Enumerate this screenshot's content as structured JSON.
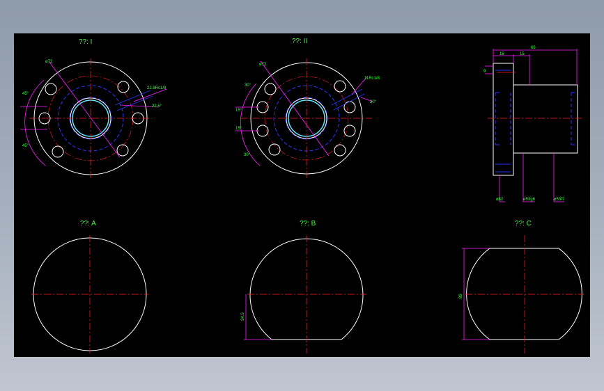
{
  "views": {
    "view_1": {
      "title": "??: I"
    },
    "view_2": {
      "title": "??: II"
    },
    "view_a": {
      "title": "??: A"
    },
    "view_b": {
      "title": "??: B"
    },
    "view_c": {
      "title": "??: C"
    }
  },
  "dims": {
    "v1_dia": "ø72",
    "v1_ang_top": "45°",
    "v1_ang_bot": "45°",
    "v1_hole": "22.9Rc1/8",
    "v1_offset": "22.5°",
    "v2_dia": "ø72",
    "v2_ang1": "30°",
    "v2_ang2": "15°",
    "v2_ang3": "15°",
    "v2_ang4": "30°",
    "v2_hole": "11Rc1/8",
    "v2_offset": "30°",
    "side_len": "66",
    "side_w1": "16",
    "side_w2": "15",
    "side_small": "9",
    "side_d1": "ø82",
    "side_d2": "ø53g6",
    "side_d3": "ø53f7",
    "b_cut": "34.5",
    "c_width": "89"
  },
  "colors": {
    "outline": "#ffffff",
    "centerline": "#ff2020",
    "hidden": "#2a35ff",
    "dimension": "#ff20ff",
    "text": "#3dff3d",
    "bore": "#5fe8ff"
  }
}
